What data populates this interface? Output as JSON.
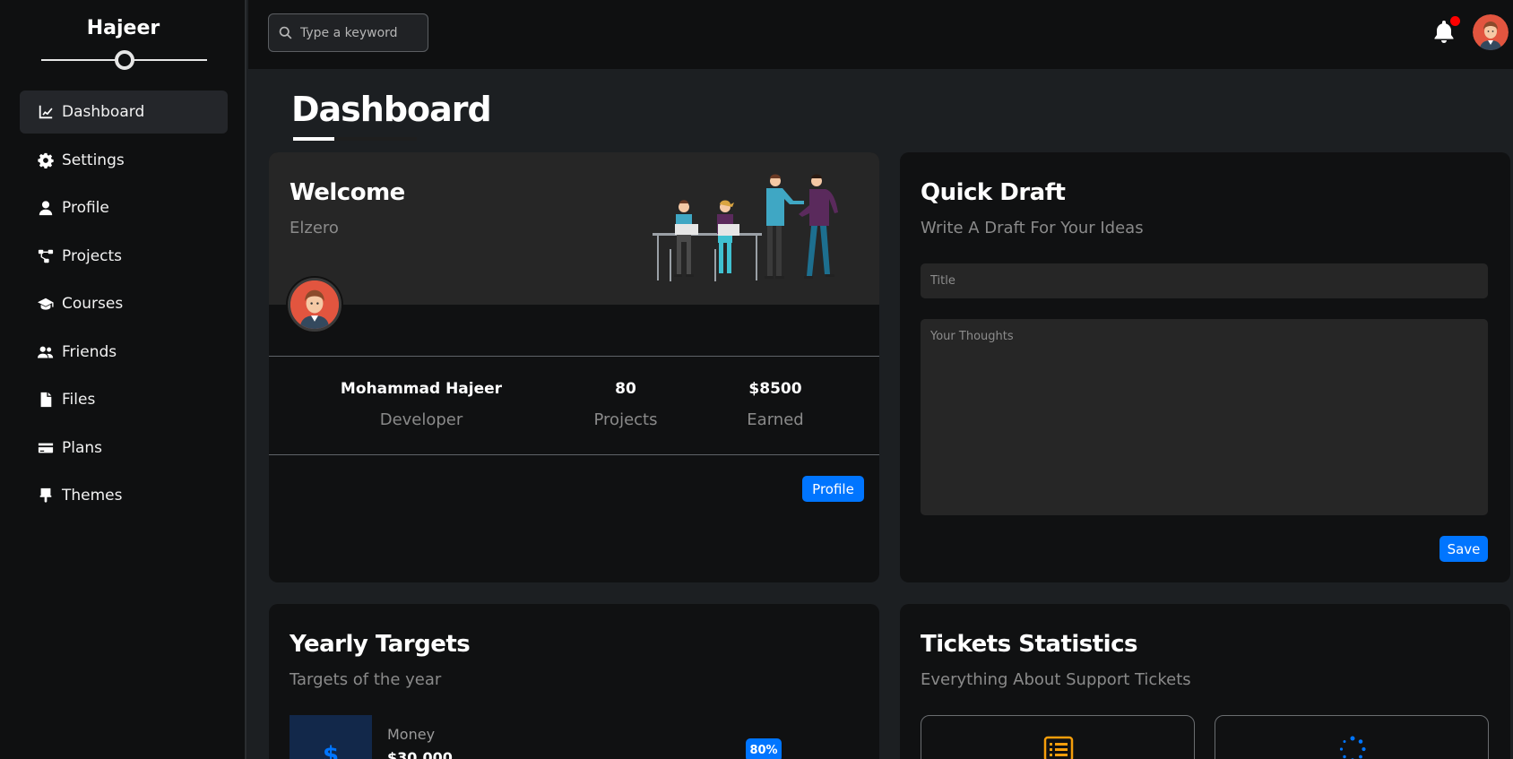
{
  "sidebar": {
    "brand": "Hajeer",
    "items": [
      {
        "label": "Dashboard",
        "icon": "chart-line-icon"
      },
      {
        "label": "Settings",
        "icon": "gear-icon"
      },
      {
        "label": "Profile",
        "icon": "user-icon"
      },
      {
        "label": "Projects",
        "icon": "diagram-project-icon"
      },
      {
        "label": "Courses",
        "icon": "graduation-cap-icon"
      },
      {
        "label": "Friends",
        "icon": "users-icon"
      },
      {
        "label": "Files",
        "icon": "file-icon"
      },
      {
        "label": "Plans",
        "icon": "credit-card-icon"
      },
      {
        "label": "Themes",
        "icon": "paint-brush-icon"
      }
    ],
    "active": "Dashboard"
  },
  "topbar": {
    "search_placeholder": "Type a keyword",
    "notification_dot_color": "#ff0000"
  },
  "page": {
    "title": "Dashboard"
  },
  "welcome": {
    "title": "Welcome",
    "subtitle": "Elzero",
    "name": "Mohammad Hajeer",
    "role": "Developer",
    "projects_value": "80",
    "projects_label": "Projects",
    "earned_value": "$8500",
    "earned_label": "Earned",
    "button": "Profile"
  },
  "draft": {
    "title": "Quick Draft",
    "subtitle": "Write A Draft For Your Ideas",
    "title_placeholder": "Title",
    "body_placeholder": "Your Thoughts",
    "button": "Save"
  },
  "targets": {
    "title": "Yearly Targets",
    "subtitle": "Targets of the year",
    "money_label": "Money",
    "money_value": "$30,000",
    "money_percent": "80%"
  },
  "tickets": {
    "title": "Tickets Statistics",
    "subtitle": "Everything About Support Tickets"
  },
  "colors": {
    "accent": "#0075ff",
    "sidebar": "#0f1011",
    "card": "#101112"
  }
}
